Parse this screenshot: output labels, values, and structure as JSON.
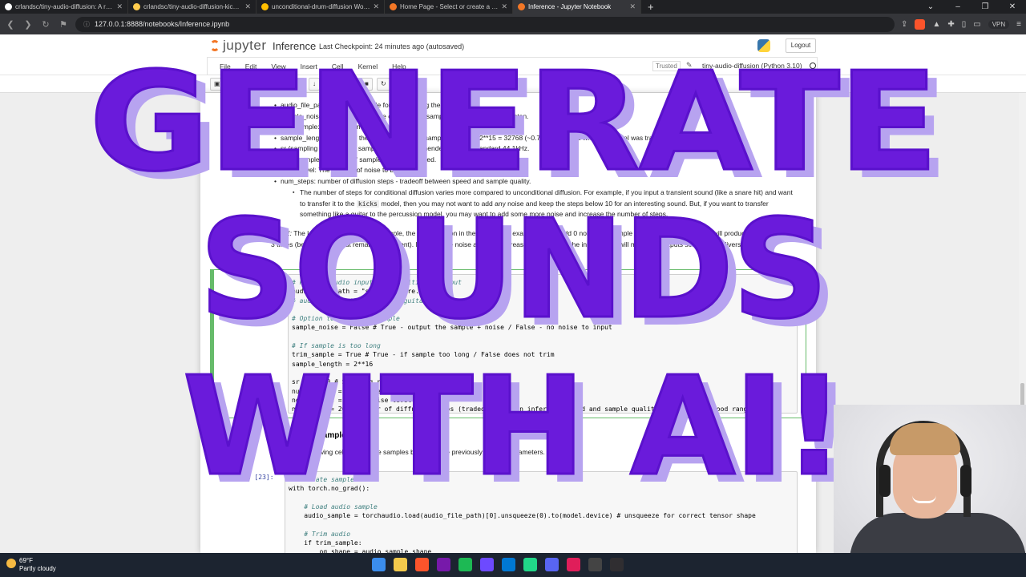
{
  "browser": {
    "tabs": [
      {
        "label": "crlandsc/tiny-audio-diffusion: A repo",
        "icon": "github-icon",
        "color": "#ffffff"
      },
      {
        "label": "crlandsc/tiny-audio-diffusion-kicks at",
        "icon": "huggingface-icon",
        "color": "#ffcc4d"
      },
      {
        "label": "unconditional-drum-diffusion Worksp",
        "icon": "wandb-icon",
        "color": "#ffbe00"
      },
      {
        "label": "Home Page - Select or create a noteb",
        "icon": "jupyter-icon",
        "color": "#f37726"
      },
      {
        "label": "Inference - Jupyter Notebook",
        "icon": "jupyter-icon",
        "color": "#f37726",
        "active": true
      }
    ],
    "url": "127.0.0.1:8888/notebooks/Inference.ipynb",
    "vpn": "VPN",
    "new_tab": "+",
    "win_controls": [
      "⌄",
      "–",
      "❐",
      "✕"
    ]
  },
  "jupyter": {
    "logo_text": "jupyter",
    "notebook_name": "Inference",
    "checkpoint": "Last Checkpoint: 24 minutes ago  (autosaved)",
    "logout": "Logout",
    "menus": [
      "File",
      "Edit",
      "View",
      "Insert",
      "Cell",
      "Kernel",
      "Help"
    ],
    "trusted": "Trusted",
    "kernel": "tiny-audio-diffusion (Python 3.10)",
    "toolbar_run": "Run"
  },
  "markdown": {
    "bullets": [
      "audio_file_path: path to a sample for conditioning the model.",
      "sample_noise: Option to output the conditioning sample with noise added to listen.",
      "trim_sample: Option to trim sample.",
      "sample_length: Length of the output sample (in samples). Default 2**15 = 32768 (~0.75 s) as that is what the model was trained on.",
      "sr (sampling rate): output sampling rate; recommended industry standard 44.1kHz.",
      "num_samples: number of samples to be generated.",
      "noise_level: The amount of noise to be added.",
      "num_steps: number of diffusion steps - tradeoff between speed and sample quality."
    ],
    "sub_bullet": "The number of steps for conditional diffusion varies more compared to unconditional diffusion. For example, if you input a transient sound (like a snare hit) and want to transfer it to the",
    "sub_bullet_code": "kicks",
    "sub_bullet_rest": "model, then you may not want to add any noise and keep the steps below 10 for an interesting sound. But, if you want to transfer something like a guitar to the percussion model, you may want to add some more noise and increase the number of steps.",
    "note_label": "NOTE:",
    "note_text": "The less noise is added to a sample, the less variation in the output. For example, if you add 0 noise to a sample and generate it 3 times, it will produce the same output 3 times (because the input remains consistent). Increase the noise added to increase the variety of the input, which will make the outputs sound more diverse as well.",
    "run_heading": "Generate Samples",
    "run_desc": "Run the following cell to generate samples based on the previously defined parameters."
  },
  "cells": {
    "cell1_prompt": "In [ ]:",
    "cell1_lines": [
      {
        "t": "# Path to audio input for conditional output",
        "c": "cm"
      },
      {
        "t": "audio_file_path = \"samples/snare.wav\"",
        "c": ""
      },
      {
        "t": "# audio_file_path = \"samples/guitar.wav\"",
        "c": "cm"
      },
      {
        "t": "",
        "c": ""
      },
      {
        "t": "# Option to noise the sample",
        "c": "cm"
      },
      {
        "t": "sample_noise = False # True - output the sample + noise / False - no noise to input",
        "c": ""
      },
      {
        "t": "",
        "c": ""
      },
      {
        "t": "# If sample is too long",
        "c": "cm"
      },
      {
        "t": "trim_sample = True # True - if sample too long / False does not trim",
        "c": ""
      },
      {
        "t": "sample_length = 2**16",
        "c": ""
      },
      {
        "t": "",
        "c": ""
      },
      {
        "t": "sr = 44100 # Sampling rate",
        "c": ""
      },
      {
        "t": "num_samples = 3 # Number of samples",
        "c": ""
      },
      {
        "t": "noise_level = 0.3 # Noise level",
        "c": ""
      },
      {
        "t": "num_steps = 20 # Number of diffusion steps (tradeoff between inference speed and sample quality (10-100 is a good range)",
        "c": ""
      }
    ],
    "cell2_prompt": "In [23]:",
    "cell2_lines": [
      {
        "t": "# Generate samples",
        "c": "cm"
      },
      {
        "t": "with torch.no_grad():",
        "c": ""
      },
      {
        "t": "",
        "c": ""
      },
      {
        "t": "    # Load audio sample",
        "c": "cm"
      },
      {
        "t": "    audio_sample = torchaudio.load(audio_file_path)[0].unsqueeze(0).to(model.device) # unsqueeze for correct tensor shape",
        "c": ""
      },
      {
        "t": "",
        "c": ""
      },
      {
        "t": "    # Trim audio",
        "c": "cm"
      },
      {
        "t": "    if trim_sample:",
        "c": ""
      },
      {
        "t": "        og_shape = audio_sample.shape",
        "c": ""
      }
    ]
  },
  "overlay": {
    "line1": "GENERATE",
    "line2": "SOUNDS",
    "line3": "WITH AI!",
    "color": "#6a1bdb",
    "shadow": "#b7a3f0"
  },
  "taskbar": {
    "temp": "69°F",
    "condition": "Partly cloudy",
    "apps": [
      {
        "name": "windows-start-icon",
        "color": "#3b8ded"
      },
      {
        "name": "file-explorer-icon",
        "color": "#f2c94c"
      },
      {
        "name": "brave-browser-icon",
        "color": "#fb542b"
      },
      {
        "name": "onenote-icon",
        "color": "#7719aa"
      },
      {
        "name": "spotify-icon",
        "color": "#1db954"
      },
      {
        "name": "proton-vpn-icon",
        "color": "#6d4aff"
      },
      {
        "name": "vscode-icon",
        "color": "#0078d4"
      },
      {
        "name": "pycharm-icon",
        "color": "#21d789"
      },
      {
        "name": "discord-icon",
        "color": "#5865f2"
      },
      {
        "name": "slack-icon",
        "color": "#e01e5a"
      },
      {
        "name": "terminal-icon",
        "color": "#444444"
      },
      {
        "name": "obs-icon",
        "color": "#302e31"
      }
    ]
  }
}
